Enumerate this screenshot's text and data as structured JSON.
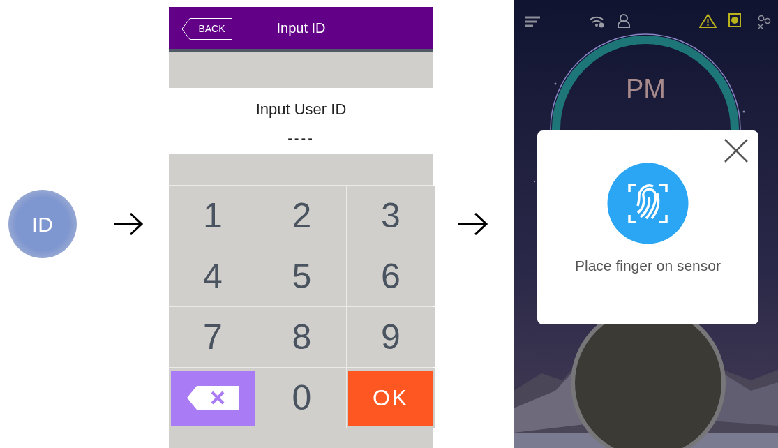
{
  "id_button": {
    "label": "ID"
  },
  "input_screen": {
    "back_button": "BACK",
    "title": "Input ID",
    "prompt": "Input User ID",
    "id_value": "----",
    "keys": [
      {
        "kind": "digit",
        "label": "1"
      },
      {
        "kind": "digit",
        "label": "2"
      },
      {
        "kind": "digit",
        "label": "3"
      },
      {
        "kind": "digit",
        "label": "4"
      },
      {
        "kind": "digit",
        "label": "5"
      },
      {
        "kind": "digit",
        "label": "6"
      },
      {
        "kind": "digit",
        "label": "7"
      },
      {
        "kind": "digit",
        "label": "8"
      },
      {
        "kind": "digit",
        "label": "9"
      },
      {
        "kind": "backspace"
      },
      {
        "kind": "digit",
        "label": "0"
      },
      {
        "kind": "ok",
        "label": "OK"
      }
    ]
  },
  "scan_screen": {
    "clock": {
      "period": "PM"
    },
    "dialog": {
      "message": "Place finger on sensor"
    }
  }
}
